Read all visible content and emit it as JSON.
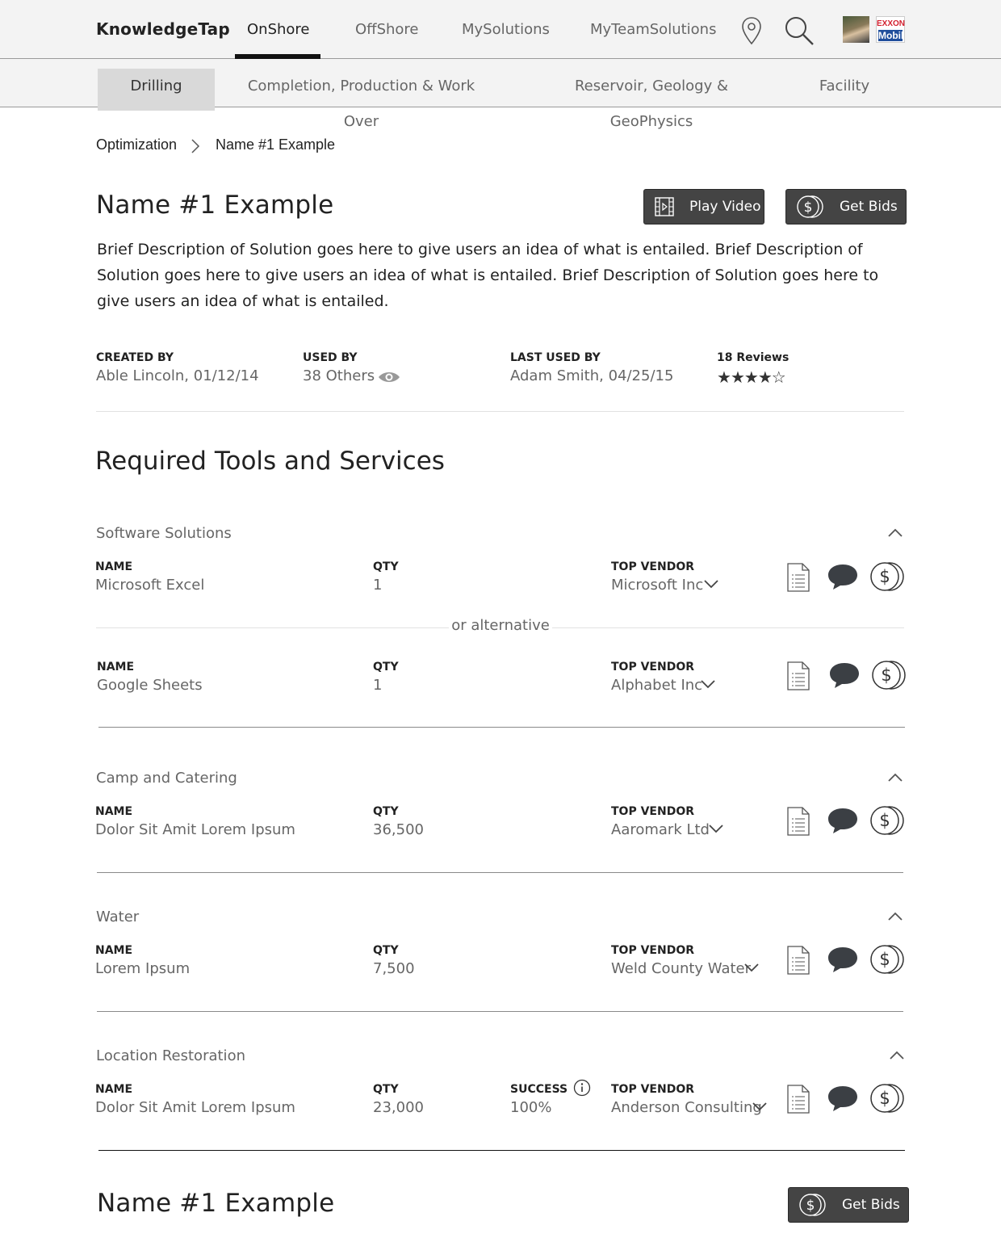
{
  "app": {
    "brand": "KnowledgeTap",
    "nav": [
      "OnShore",
      "OffShore",
      "MySolutions",
      "MyTeamSolutions"
    ],
    "logo_top": "EXXON",
    "logo_bottom": "Mobil"
  },
  "subnav": [
    "Drilling",
    "Completion, Production & Work Over",
    "Reservoir, Geology & GeoPhysics",
    "Facility"
  ],
  "breadcrumb": [
    "Optimization",
    "Name #1 Example"
  ],
  "solution": {
    "title": "Name #1 Example",
    "play_video": "Play Video",
    "get_bids": "Get Bids",
    "description": "Brief Description of Solution goes here to give users an idea of what is entailed. Brief Description of Solution goes here to give users an idea of what is entailed. Brief Description of Solution goes here to give users an idea of what is entailed."
  },
  "meta": {
    "created_label": "CREATED BY",
    "created_value": "Able Lincoln, 01/12/14",
    "used_label": "USED BY",
    "used_value": "38 Others",
    "last_label": "LAST USED BY",
    "last_value": "Adam Smith, 04/25/15",
    "reviews_label": "18 Reviews",
    "rating": 4,
    "rating_max": 5
  },
  "required_title": "Required Tools and Services",
  "labels": {
    "name": "NAME",
    "qty": "QTY",
    "vendor": "TOP VENDOR",
    "success": "SUCCESS",
    "alternative": "or alternative"
  },
  "sections": [
    {
      "title": "Software Solutions",
      "rows": [
        {
          "name": "Microsoft Excel",
          "qty": "1",
          "vendor": "Microsoft Inc"
        },
        {
          "name": "Google Sheets",
          "qty": "1",
          "vendor": "Alphabet Inc"
        }
      ]
    },
    {
      "title": "Camp and Catering",
      "rows": [
        {
          "name": "Dolor Sit Amit Lorem Ipsum",
          "qty": "36,500",
          "vendor": "Aaromark Ltd"
        }
      ]
    },
    {
      "title": "Water",
      "rows": [
        {
          "name": "Lorem Ipsum",
          "qty": "7,500",
          "vendor": "Weld County Water"
        }
      ]
    },
    {
      "title": "Location Restoration",
      "rows": [
        {
          "name": "Dolor Sit Amit Lorem Ipsum",
          "qty": "23,000",
          "success": "100%",
          "vendor": "Anderson Consulting"
        }
      ]
    }
  ],
  "next_solution": {
    "title": "Name #1 Example",
    "get_bids": "Get Bids"
  },
  "colors": {
    "button_bg": "#444444",
    "nav_bg": "#f3f3f3",
    "active_subtab": "#d9d9d9"
  },
  "icons": [
    "map-pin-icon",
    "search-icon",
    "film-icon",
    "dollar-coin-icon",
    "eye-icon",
    "chevron-right-icon",
    "chevron-up-icon",
    "chevron-down-icon",
    "document-list-icon",
    "chat-bubble-icon",
    "info-icon"
  ]
}
